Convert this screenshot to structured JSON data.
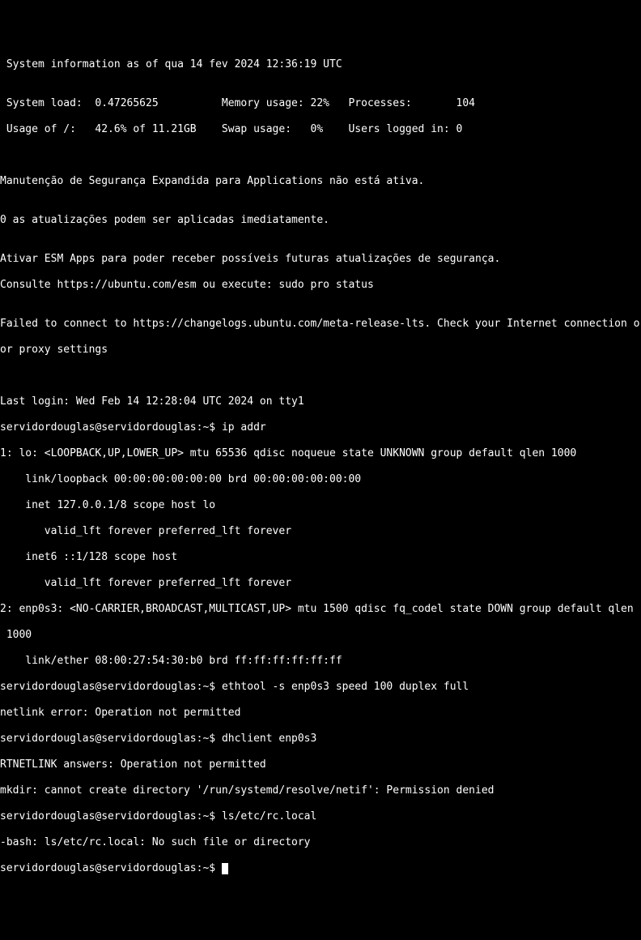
{
  "motd": {
    "sysinfo_header": " System information as of qua 14 fev 2024 12:36:19 UTC",
    "blank": "",
    "row1": " System load:  0.47265625          Memory usage: 22%   Processes:       104",
    "row2": " Usage of /:   42.6% of 11.21GB    Swap usage:   0%    Users logged in: 0",
    "esm1": "Manutenção de Segurança Expandida para Applications não está ativa.",
    "esm2": "0 as atualizações podem ser aplicadas imediatamente.",
    "esm3": "Ativar ESM Apps para poder receber possíveis futuras atualizações de segurança.",
    "esm4": "Consulte https://ubuntu.com/esm ou execute: sudo pro status",
    "fail1": "Failed to connect to https://changelogs.ubuntu.com/meta-release-lts. Check your Internet connection o",
    "fail2": "or proxy settings",
    "lastlogin": "Last login: Wed Feb 14 12:28:04 UTC 2024 on tty1"
  },
  "session": {
    "prompt": "servidordouglas@servidordouglas:~$ ",
    "cmd1": "ip addr",
    "out1": "1: lo: <LOOPBACK,UP,LOWER_UP> mtu 65536 qdisc noqueue state UNKNOWN group default qlen 1000",
    "out2": "    link/loopback 00:00:00:00:00:00 brd 00:00:00:00:00:00",
    "out3": "    inet 127.0.0.1/8 scope host lo",
    "out4": "       valid_lft forever preferred_lft forever",
    "out5": "    inet6 ::1/128 scope host",
    "out6": "       valid_lft forever preferred_lft forever",
    "out7": "2: enp0s3: <NO-CARRIER,BROADCAST,MULTICAST,UP> mtu 1500 qdisc fq_codel state DOWN group default qlen",
    "out8": " 1000",
    "out9": "    link/ether 08:00:27:54:30:b0 brd ff:ff:ff:ff:ff:ff",
    "cmd2": "ethtool -s enp0s3 speed 100 duplex full",
    "err2": "netlink error: Operation not permitted",
    "cmd3": "dhclient enp0s3",
    "err3a": "RTNETLINK answers: Operation not permitted",
    "err3b": "mkdir: cannot create directory '/run/systemd/resolve/netif': Permission denied",
    "cmd4": "ls/etc/rc.local",
    "err4": "-bash: ls/etc/rc.local: No such file or directory"
  }
}
